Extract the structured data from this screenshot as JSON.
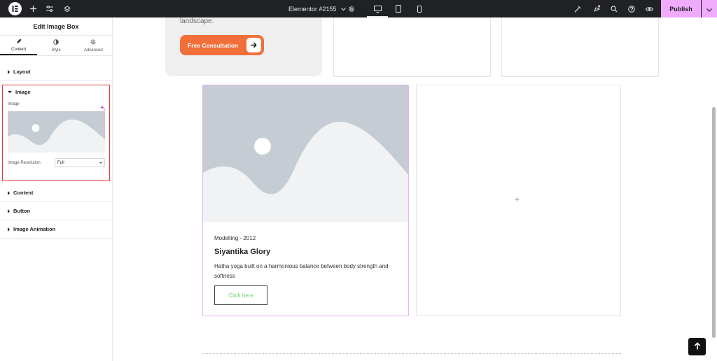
{
  "topbar": {
    "document_title": "Elementor #2155",
    "publish_label": "Publish"
  },
  "sidebar": {
    "panel_title": "Edit Image Box",
    "tabs": [
      {
        "label": "Content",
        "icon": "pencil-icon",
        "active": true
      },
      {
        "label": "Style",
        "icon": "half-circle-icon",
        "active": false
      },
      {
        "label": "Advanced",
        "icon": "gear-icon",
        "active": false
      }
    ],
    "sections": {
      "layout": "Layout",
      "image": "Image",
      "content": "Content",
      "button": "Button",
      "image_animation": "Image Animation"
    },
    "image_control_label": "Image",
    "resolution_label": "Image Resolution",
    "resolution_value": "Full"
  },
  "canvas": {
    "promo_text": "landscape.",
    "cta_label": "Free Consultation",
    "image_box": {
      "meta": "Modelling - 2012",
      "title": "Siyantika Glory",
      "description": "Hatha yoga built on a harmonious balance between body strength and softness",
      "button_label": "Click here"
    },
    "add_symbol": "+"
  },
  "colors": {
    "accent": "#f0abfc",
    "cta": "#f26f3a",
    "highlight_border": "#e53935",
    "link_green": "#6fd26f"
  }
}
